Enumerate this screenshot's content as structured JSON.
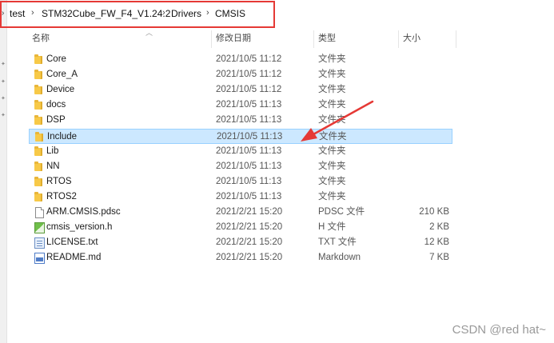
{
  "breadcrumb": {
    "items": [
      "test",
      "STM32Cube_FW_F4_V1.24.2",
      "Drivers",
      "CMSIS"
    ]
  },
  "columns": {
    "name": "名称",
    "date": "修改日期",
    "type": "类型",
    "size": "大小"
  },
  "files": [
    {
      "name": "Core",
      "date": "2021/10/5 11:12",
      "type": "文件夹",
      "size": "",
      "icon": "folder-icon"
    },
    {
      "name": "Core_A",
      "date": "2021/10/5 11:12",
      "type": "文件夹",
      "size": "",
      "icon": "folder-icon"
    },
    {
      "name": "Device",
      "date": "2021/10/5 11:12",
      "type": "文件夹",
      "size": "",
      "icon": "folder-icon"
    },
    {
      "name": "docs",
      "date": "2021/10/5 11:13",
      "type": "文件夹",
      "size": "",
      "icon": "folder-icon"
    },
    {
      "name": "DSP",
      "date": "2021/10/5 11:13",
      "type": "文件夹",
      "size": "",
      "icon": "folder-icon"
    },
    {
      "name": "Include",
      "date": "2021/10/5 11:13",
      "type": "文件夹",
      "size": "",
      "icon": "folder-icon"
    },
    {
      "name": "Lib",
      "date": "2021/10/5 11:13",
      "type": "文件夹",
      "size": "",
      "icon": "folder-icon"
    },
    {
      "name": "NN",
      "date": "2021/10/5 11:13",
      "type": "文件夹",
      "size": "",
      "icon": "folder-icon"
    },
    {
      "name": "RTOS",
      "date": "2021/10/5 11:13",
      "type": "文件夹",
      "size": "",
      "icon": "folder-icon"
    },
    {
      "name": "RTOS2",
      "date": "2021/10/5 11:13",
      "type": "文件夹",
      "size": "",
      "icon": "folder-icon"
    },
    {
      "name": "ARM.CMSIS.pdsc",
      "date": "2021/2/21 15:20",
      "type": "PDSC 文件",
      "size": "210 KB",
      "icon": "file-icon"
    },
    {
      "name": "cmsis_version.h",
      "date": "2021/2/21 15:20",
      "type": "H 文件",
      "size": "2 KB",
      "icon": "code-file-icon"
    },
    {
      "name": "LICENSE.txt",
      "date": "2021/2/21 15:20",
      "type": "TXT 文件",
      "size": "12 KB",
      "icon": "text-file-icon"
    },
    {
      "name": "README.md",
      "date": "2021/2/21 15:20",
      "type": "Markdown",
      "size": "7 KB",
      "icon": "markdown-file-icon"
    }
  ],
  "selected_index": 5,
  "annotation_color": "#e53935",
  "watermark": "CSDN @red hat~"
}
